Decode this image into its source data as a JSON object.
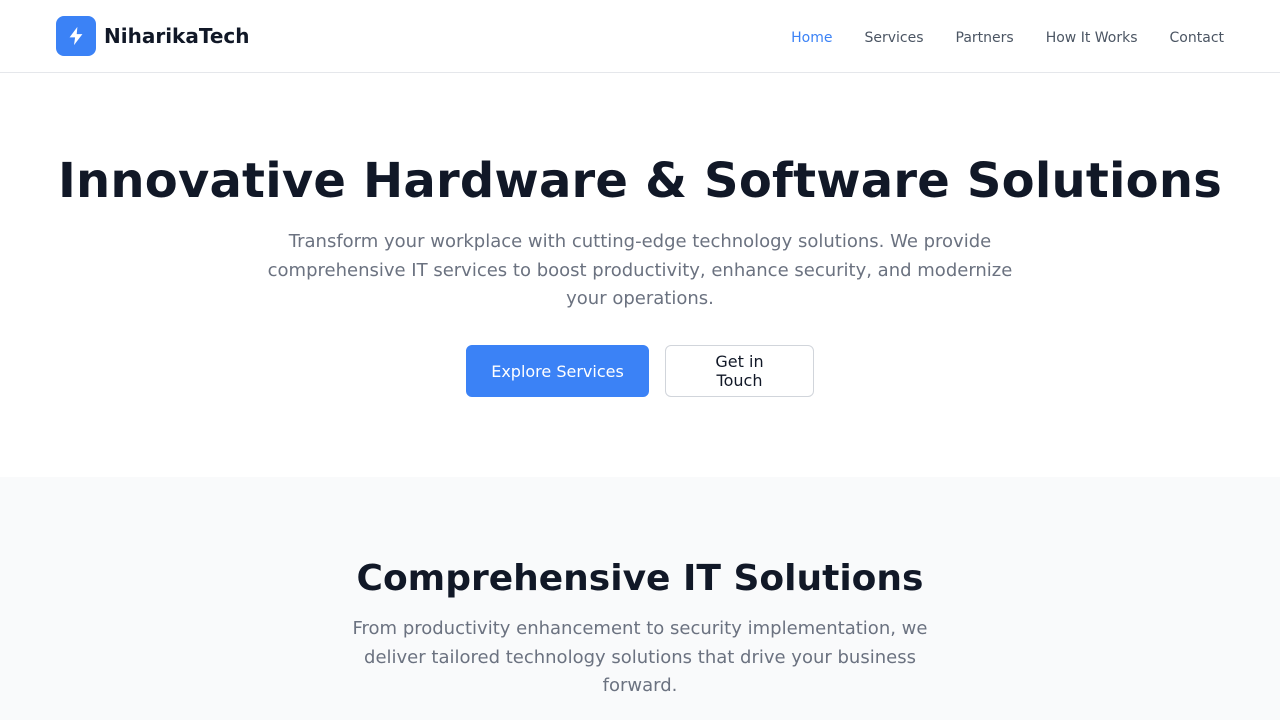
{
  "brand": {
    "name": "NiharikaTech",
    "logo_icon": "lightning-bolt-icon",
    "accent_color": "#3b82f6"
  },
  "nav": {
    "items": [
      {
        "label": "Home",
        "active": true
      },
      {
        "label": "Services",
        "active": false
      },
      {
        "label": "Partners",
        "active": false
      },
      {
        "label": "How It Works",
        "active": false
      },
      {
        "label": "Contact",
        "active": false
      }
    ]
  },
  "hero": {
    "title": "Innovative Hardware & Software Solutions",
    "subtitle": "Transform your workplace with cutting-edge technology solutions. We provide comprehensive IT services to boost productivity, enhance security, and modernize your operations.",
    "primary_button": "Explore Services",
    "secondary_button": "Get in Touch"
  },
  "solutions": {
    "title": "Comprehensive IT Solutions",
    "subtitle": "From productivity enhancement to security implementation, we deliver tailored technology solutions that drive your business forward."
  }
}
